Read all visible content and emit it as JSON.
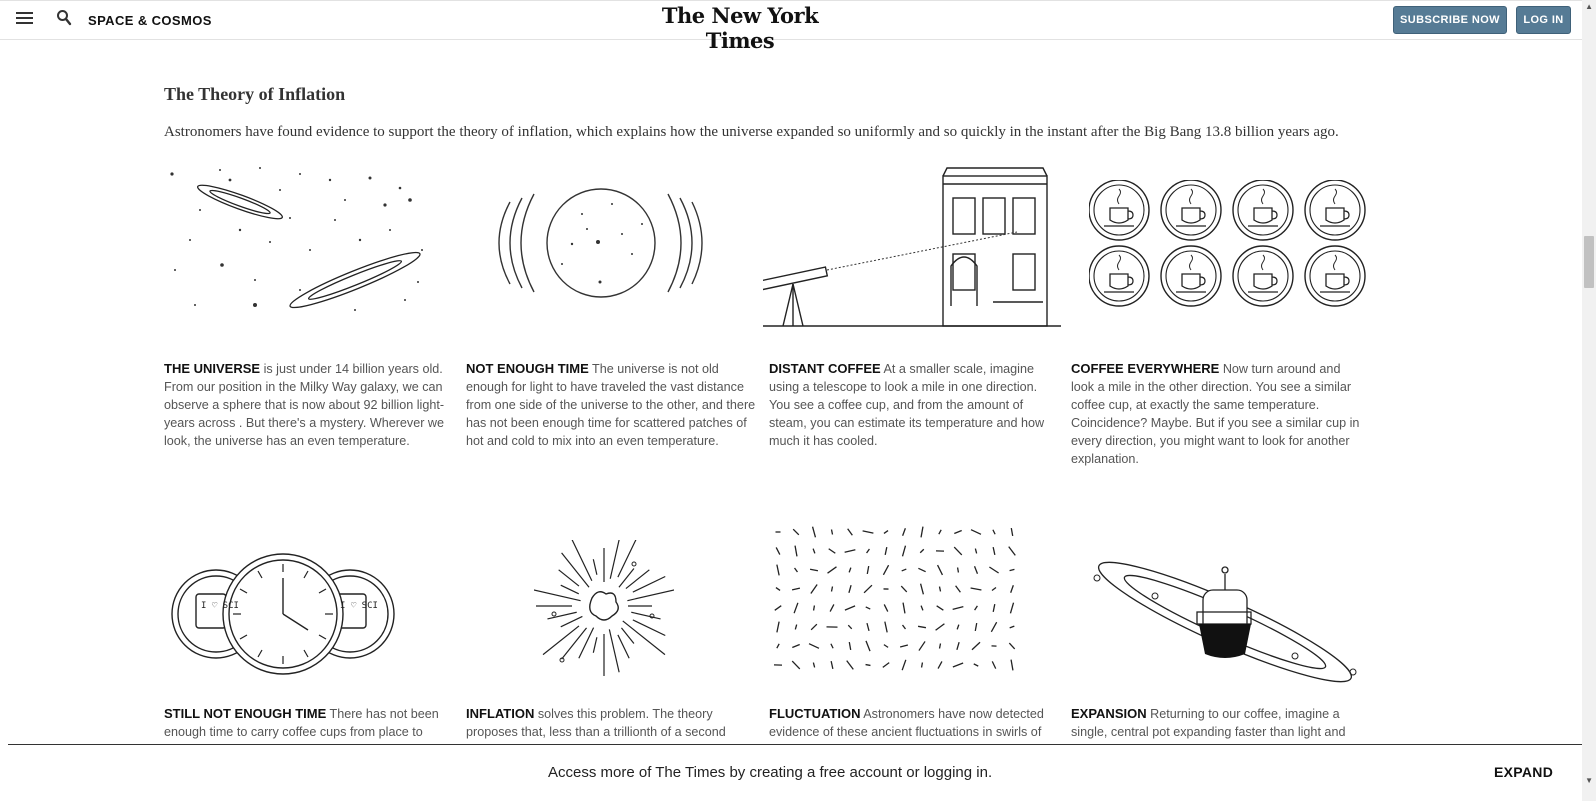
{
  "header": {
    "section": "SPACE & COSMOS",
    "logo": "The New York Times",
    "subscribe": "SUBSCRIBE NOW",
    "login": "LOG IN",
    "button_color": "#567b95"
  },
  "article": {
    "heading": "The Theory of Inflation",
    "intro": "Astronomers have found evidence to support the theory of inflation, which explains how the universe expanded so uniformly and so quickly in the instant after the Big Bang 13.8 billion years ago.",
    "row1": [
      {
        "lead": "THE UNIVERSE",
        "text": " is just under 14 billion years old. From our position in the Milky Way galaxy, we can observe a sphere that is now about 92 billion light-years across . But there's a mystery. Wherever we look, the universe has an even temperature."
      },
      {
        "lead": "NOT ENOUGH TIME",
        "text": " The universe is not old enough for light to have traveled the vast distance from one side of the universe to the other, and there has not been enough time for scattered patches of hot and cold to mix into an even temperature."
      },
      {
        "lead": "DISTANT COFFEE",
        "text": " At a smaller scale, imagine using a telescope to look a mile in one direction. You see a coffee cup, and from the amount of steam, you can estimate its temperature and how much it has cooled."
      },
      {
        "lead": "COFFEE EVERYWHERE",
        "text": " Now turn around and look a mile in the other direction. You see a similar coffee cup, at exactly the same temperature. Coincidence? Maybe. But if you see a similar cup in every direction, you might want to look for another explanation."
      }
    ],
    "row2": [
      {
        "lead": "STILL NOT ENOUGH TIME",
        "text": " There has not been enough time to carry coffee cups from place to"
      },
      {
        "lead": "INFLATION",
        "text": " solves this problem. The theory proposes that, less than a trillionth of a second"
      },
      {
        "lead": "FLUCTUATION",
        "text": " Astronomers have now detected evidence of these ancient fluctuations in swirls of"
      },
      {
        "lead": "EXPANSION",
        "text": " Returning to our coffee, imagine a single, central pot expanding faster than light and"
      }
    ],
    "mug_text": "I ♡ SCI"
  },
  "footer": {
    "message": "Access more of The Times by creating a free account or logging in.",
    "expand": "EXPAND"
  }
}
